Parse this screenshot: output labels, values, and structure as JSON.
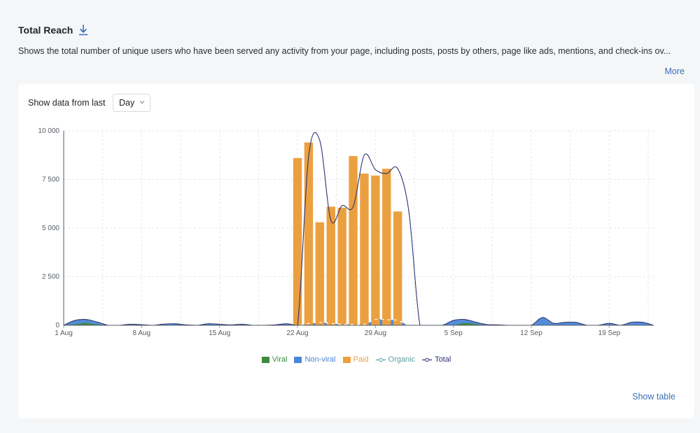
{
  "header": {
    "title": "Total Reach",
    "description": "Shows the total number of unique users who have been served any activity from your page, including posts, posts by others, page like ads, mentions, and check-ins ov...",
    "more_label": "More"
  },
  "controls": {
    "range_label": "Show data from last",
    "range_value": "Day"
  },
  "footer": {
    "show_table_label": "Show table"
  },
  "colors": {
    "viral": "#3d8b3d",
    "nonviral": "#4a86d8",
    "paid": "#eba040",
    "organic": "#5aa0a0",
    "total": "#2c3470",
    "grid": "#e3e6ea"
  },
  "chart_data": {
    "type": "bar",
    "title": "",
    "xlabel": "",
    "ylabel": "",
    "ylim": [
      0,
      10000
    ],
    "yticks": [
      0,
      2500,
      5000,
      7500,
      10000
    ],
    "ytick_labels": [
      "0",
      "2 500",
      "5 000",
      "7 500",
      "10 000"
    ],
    "xtick_labels": [
      "1 Aug",
      "8 Aug",
      "15 Aug",
      "22 Aug",
      "29 Aug",
      "5 Sep",
      "12 Sep",
      "19 Sep"
    ],
    "xtick_days": [
      1,
      8,
      15,
      22,
      29,
      36,
      43,
      50
    ],
    "x_days_start": 1,
    "x_days_end": 54,
    "grid": true,
    "legend_position": "bottom",
    "categories": [
      "1 Aug",
      "2 Aug",
      "3 Aug",
      "4 Aug",
      "5 Aug",
      "6 Aug",
      "7 Aug",
      "8 Aug",
      "9 Aug",
      "10 Aug",
      "11 Aug",
      "12 Aug",
      "13 Aug",
      "14 Aug",
      "15 Aug",
      "16 Aug",
      "17 Aug",
      "18 Aug",
      "19 Aug",
      "20 Aug",
      "21 Aug",
      "22 Aug",
      "23 Aug",
      "24 Aug",
      "25 Aug",
      "26 Aug",
      "27 Aug",
      "28 Aug",
      "29 Aug",
      "30 Aug",
      "31 Aug",
      "1 Sep",
      "2 Sep",
      "3 Sep",
      "4 Sep",
      "5 Sep",
      "6 Sep",
      "7 Sep",
      "8 Sep",
      "9 Sep",
      "10 Sep",
      "11 Sep",
      "12 Sep",
      "13 Sep",
      "14 Sep",
      "15 Sep",
      "16 Sep",
      "17 Sep",
      "18 Sep",
      "19 Sep",
      "20 Sep",
      "21 Sep",
      "22 Sep",
      "23 Sep"
    ],
    "series": [
      {
        "name": "Viral",
        "type": "area",
        "values": [
          0,
          50,
          120,
          40,
          0,
          0,
          0,
          0,
          0,
          0,
          0,
          0,
          0,
          0,
          0,
          0,
          0,
          0,
          0,
          0,
          0,
          0,
          0,
          0,
          0,
          0,
          0,
          0,
          0,
          0,
          0,
          0,
          0,
          0,
          0,
          0,
          120,
          60,
          0,
          0,
          0,
          0,
          0,
          0,
          0,
          0,
          0,
          0,
          0,
          0,
          0,
          0,
          0,
          0
        ]
      },
      {
        "name": "Non-viral",
        "type": "area",
        "values": [
          0,
          200,
          180,
          130,
          0,
          0,
          50,
          30,
          0,
          60,
          80,
          20,
          0,
          80,
          50,
          20,
          50,
          0,
          0,
          20,
          80,
          0,
          100,
          150,
          100,
          50,
          50,
          50,
          300,
          280,
          250,
          0,
          0,
          0,
          0,
          250,
          180,
          100,
          40,
          20,
          0,
          0,
          0,
          400,
          100,
          150,
          150,
          0,
          0,
          100,
          0,
          150,
          150,
          0
        ]
      },
      {
        "name": "Paid",
        "type": "bar",
        "values": [
          0,
          0,
          0,
          0,
          0,
          0,
          0,
          0,
          0,
          0,
          0,
          0,
          0,
          0,
          0,
          0,
          0,
          0,
          0,
          0,
          0,
          8600,
          9400,
          5300,
          6100,
          6050,
          8700,
          7800,
          7700,
          8050,
          5850,
          0,
          0,
          0,
          0,
          0,
          0,
          0,
          0,
          0,
          0,
          0,
          0,
          0,
          0,
          0,
          0,
          0,
          0,
          0,
          0,
          0,
          0,
          0
        ]
      },
      {
        "name": "Organic",
        "type": "line",
        "values": [
          0,
          250,
          300,
          170,
          0,
          0,
          50,
          30,
          0,
          60,
          80,
          20,
          0,
          80,
          50,
          20,
          50,
          0,
          0,
          20,
          80,
          0,
          100,
          150,
          100,
          50,
          50,
          50,
          300,
          280,
          250,
          0,
          0,
          0,
          0,
          250,
          300,
          160,
          40,
          20,
          0,
          0,
          0,
          400,
          100,
          150,
          150,
          0,
          0,
          100,
          0,
          150,
          150,
          0
        ]
      },
      {
        "name": "Total",
        "type": "line",
        "values": [
          0,
          250,
          300,
          170,
          0,
          0,
          50,
          30,
          0,
          60,
          80,
          20,
          0,
          80,
          50,
          20,
          50,
          0,
          0,
          20,
          80,
          0,
          8700,
          9500,
          5400,
          6150,
          6100,
          8750,
          8000,
          7800,
          8050,
          5850,
          0,
          0,
          0,
          250,
          300,
          160,
          40,
          20,
          0,
          0,
          0,
          400,
          100,
          150,
          150,
          0,
          0,
          100,
          0,
          150,
          150,
          0
        ]
      }
    ]
  }
}
